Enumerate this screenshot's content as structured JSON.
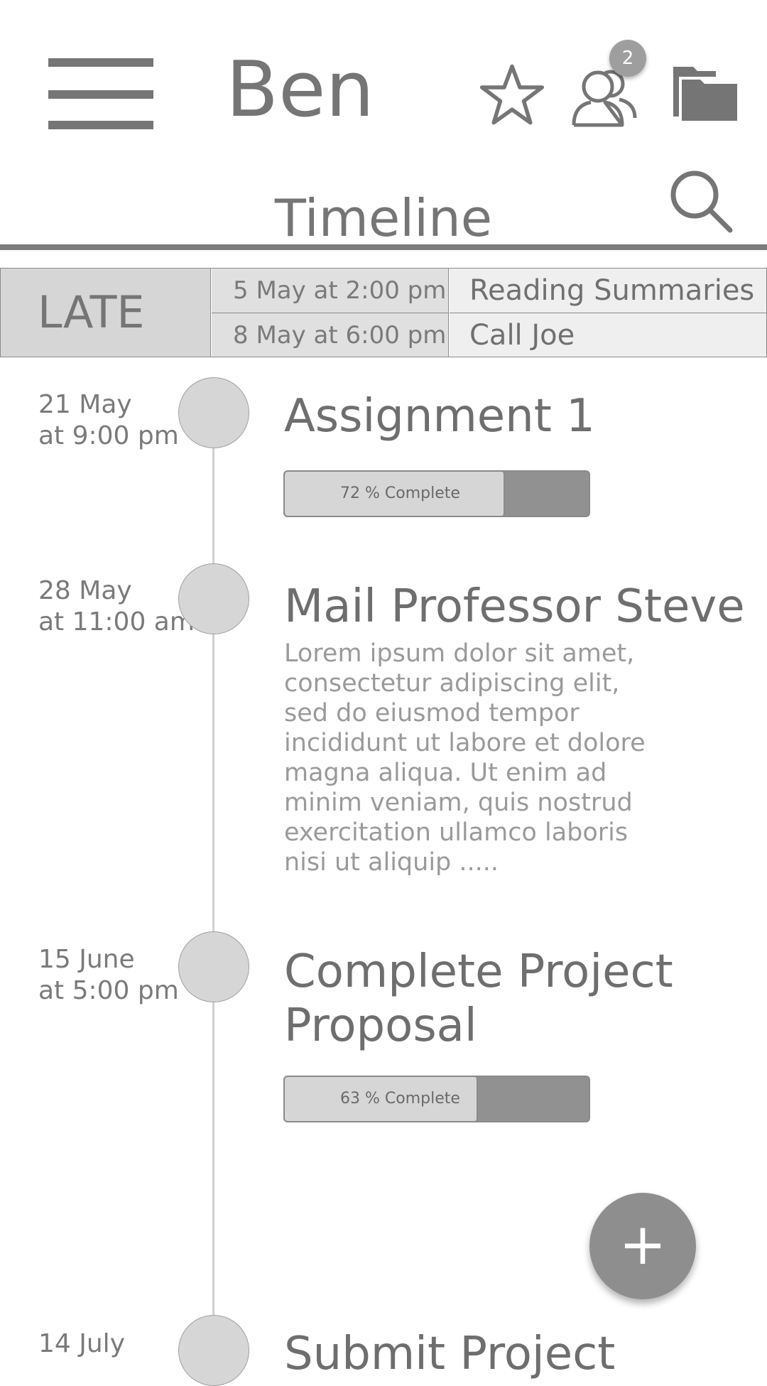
{
  "header": {
    "user_name": "Ben",
    "notification_count": "2",
    "section_title": "Timeline",
    "icons": [
      "menu-icon",
      "star-icon",
      "friends-icon",
      "folder-icon",
      "search-icon"
    ]
  },
  "late": {
    "label": "LATE",
    "rows": [
      {
        "date": "5 May at 2:00 pm",
        "task": "Reading Summaries"
      },
      {
        "date": "8 May at 6:00 pm",
        "task": "Call Joe"
      }
    ]
  },
  "timeline": [
    {
      "date": "21 May",
      "time": "at 9:00 pm",
      "title": "Assignment 1",
      "progress": 0.72,
      "progress_label": "72 % Complete"
    },
    {
      "date": "28 May",
      "time": "at 11:00 am",
      "title": "Mail Professor Steve",
      "description": "Lorem ipsum dolor sit amet, consectetur adipiscing elit, sed do eiusmod tempor incididunt ut labore et dolore magna aliqua. Ut enim ad minim veniam, quis nostrud exercitation ullamco laboris nisi ut aliquip ....."
    },
    {
      "date": "15 June",
      "time": "at 5:00 pm",
      "title_line1": "Complete Project",
      "title_line2": "Proposal",
      "progress": 0.63,
      "progress_label": "63 % Complete"
    },
    {
      "date": "14 July",
      "title": "Submit Project"
    }
  ],
  "fab": {
    "label": "+"
  },
  "colors": {
    "primary_gray": "#757575",
    "fill_light": "#d6d6d6",
    "fill_dark": "#919191"
  }
}
